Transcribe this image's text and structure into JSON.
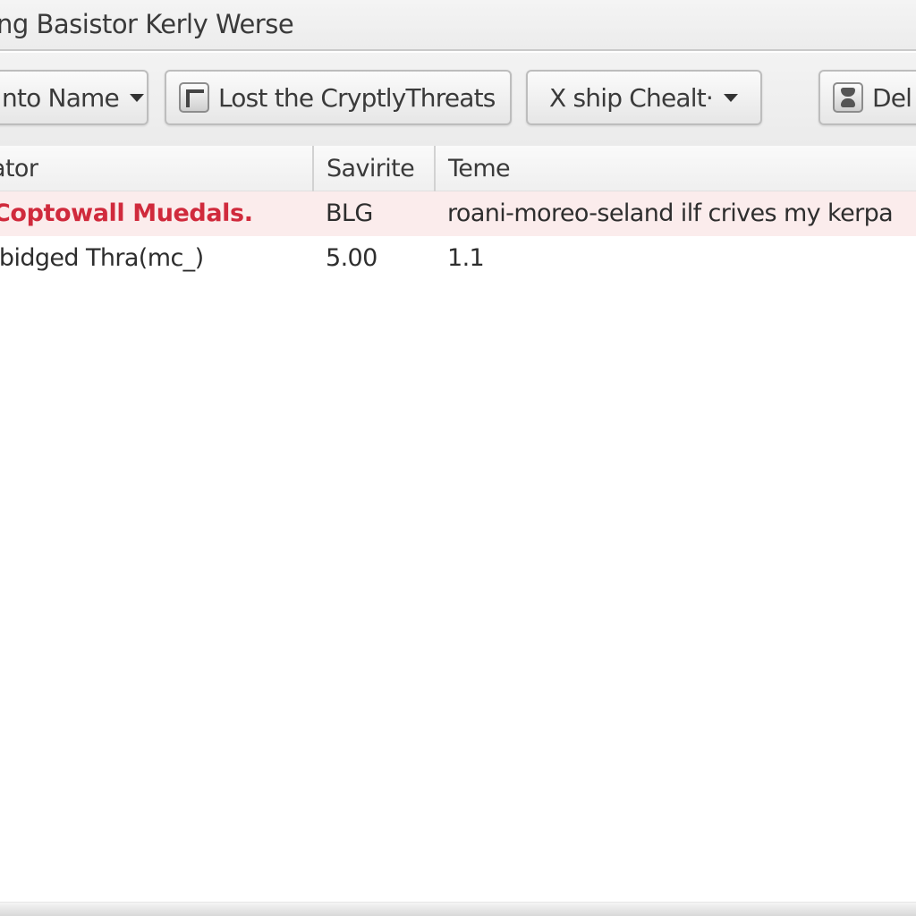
{
  "window": {
    "title": "ng Basistor Kerly Werse"
  },
  "toolbar": {
    "buttons": [
      {
        "label": "nto Name",
        "icon": "",
        "has_dropdown": true
      },
      {
        "label": "Lost the CryptlyThreats",
        "icon": "square-icon",
        "has_dropdown": false
      },
      {
        "label": "X ship Chealt·",
        "icon": "",
        "has_dropdown": true
      },
      {
        "label": "Del",
        "icon": "hourglass-icon",
        "has_dropdown": false
      }
    ]
  },
  "table": {
    "columns": [
      "ator",
      "Savirite",
      "Teme"
    ],
    "rows": [
      {
        "cells": [
          "Coptowall Muedals.",
          "BLG",
          "roani-moreo-seland ilf crives my kerpa"
        ],
        "highlighted": true
      },
      {
        "cells": [
          "lbidged Thra(mc_)",
          "5.00",
          "1.1"
        ],
        "highlighted": false
      }
    ]
  },
  "colors": {
    "highlight_text": "#d02a3c",
    "highlight_row_bg": "#fbecec"
  }
}
